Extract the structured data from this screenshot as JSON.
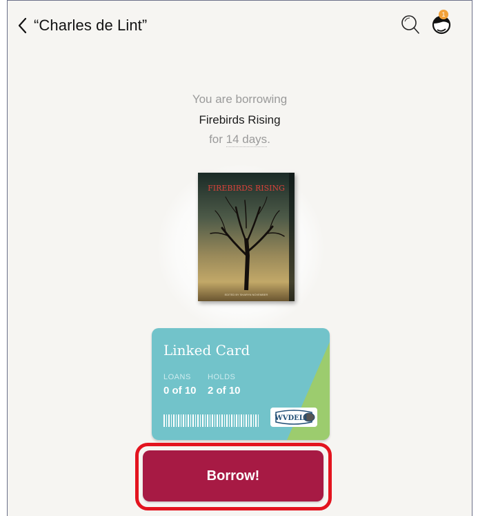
{
  "header": {
    "title": "“Charles de Lint”",
    "badge_count": "1"
  },
  "borrow_info": {
    "line1": "You are borrowing",
    "book_title": "Firebirds Rising",
    "for_text": "for",
    "duration": "14 days",
    "period": "."
  },
  "book_cover": {
    "title_text": "FIREBIRDS RISING",
    "editor_text": "EDITED BY SHARYN NOVEMBER"
  },
  "linked_card": {
    "name": "Linked Card",
    "loans_label": "LOANS",
    "loans_value": "0 of 10",
    "holds_label": "HOLDS",
    "holds_value": "2 of 10",
    "library_logo": "WVDELI"
  },
  "borrow_button": {
    "label": "Borrow!"
  },
  "colors": {
    "background": "#f6f5f2",
    "card_teal": "#72c3ca",
    "card_green": "#9ccc6e",
    "borrow_button": "#a71a44",
    "highlight_ring": "#e3141f",
    "badge": "#f2a23a"
  }
}
